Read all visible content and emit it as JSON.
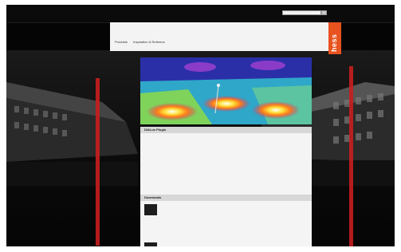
{
  "topbar": {
    "brand": "",
    "search_placeholder": ""
  },
  "nav": {
    "main": [
      "Produkte",
      "Inspiration & Referenz"
    ],
    "right": [
      "",
      "",
      "",
      ""
    ]
  },
  "logo": {
    "text": "hess"
  },
  "colors": {
    "accent": "#e8531f",
    "stripe": "#c81e1e",
    "page": "#050505"
  },
  "section1": {
    "title": "DIALux Plugin",
    "paragraphs": [
      "",
      "",
      "",
      "",
      ""
    ]
  },
  "section2": {
    "title": "Downloads",
    "items": [
      {
        "title": "",
        "sub": "",
        "link": ""
      },
      {
        "title": "",
        "sub": "",
        "link": ""
      }
    ]
  }
}
